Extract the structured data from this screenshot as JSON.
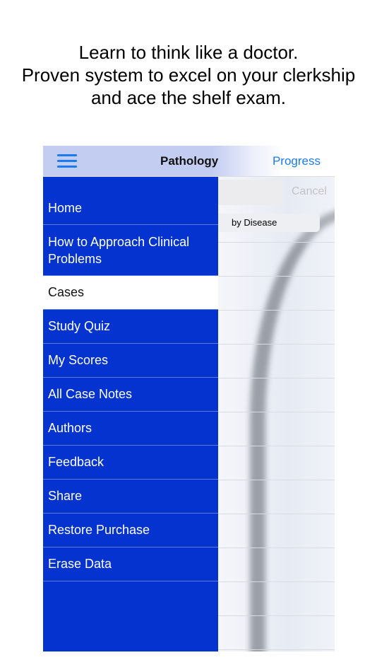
{
  "headline": [
    "Learn to think like a doctor.",
    "Proven system to excel on your clerkship",
    "and ace the shelf exam."
  ],
  "nav": {
    "title": "Pathology",
    "progress": "Progress",
    "menu_icon": "hamburger-icon"
  },
  "content": {
    "cancel": "Cancel",
    "segment": "by Disease"
  },
  "menu": {
    "items": [
      {
        "label": "Home"
      },
      {
        "label": "How to Approach Clinical Problems"
      },
      {
        "label": "Cases",
        "active": true
      },
      {
        "label": "Study Quiz"
      },
      {
        "label": "My Scores"
      },
      {
        "label": "All Case Notes"
      },
      {
        "label": "Authors"
      },
      {
        "label": "Feedback"
      },
      {
        "label": "Share"
      },
      {
        "label": "Restore Purchase"
      },
      {
        "label": "Erase Data"
      }
    ]
  },
  "colors": {
    "menu": "#0433d0",
    "accent": "#1a7cf0"
  }
}
